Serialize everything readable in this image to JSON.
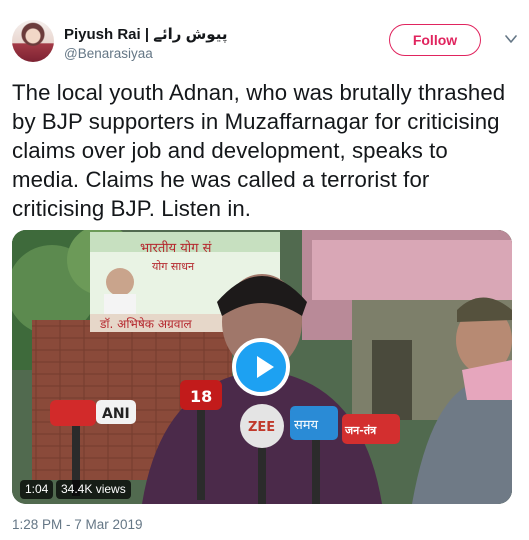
{
  "author": {
    "display_name": "Piyush Rai | پیوش رائے",
    "handle": "@Benarasiyaa"
  },
  "follow_label": "Follow",
  "tweet_text": "The local youth Adnan, who was brutally thrashed by BJP supporters in Muzaffarnagar for criticising claims over job and development, speaks to media. Claims he was called a terrorist for criticising BJP. Listen in.",
  "video": {
    "duration": "1:04",
    "views": "34.4K views",
    "banner_lines": [
      "भारतीय योग सं",
      "योग साधन",
      "डॉ. अभिषेक अग्रवाल"
    ],
    "mic_labels": [
      "ANI",
      "18",
      "ZEE",
      "समय",
      "जन-तंत्र"
    ]
  },
  "timestamp": "1:28 PM - 7 Mar 2019",
  "colors": {
    "accent": "#1da1f2",
    "follow": "#e0245e",
    "secondary_text": "#657786"
  },
  "icons": [
    "avatar",
    "chevron-down-icon",
    "play-icon"
  ]
}
